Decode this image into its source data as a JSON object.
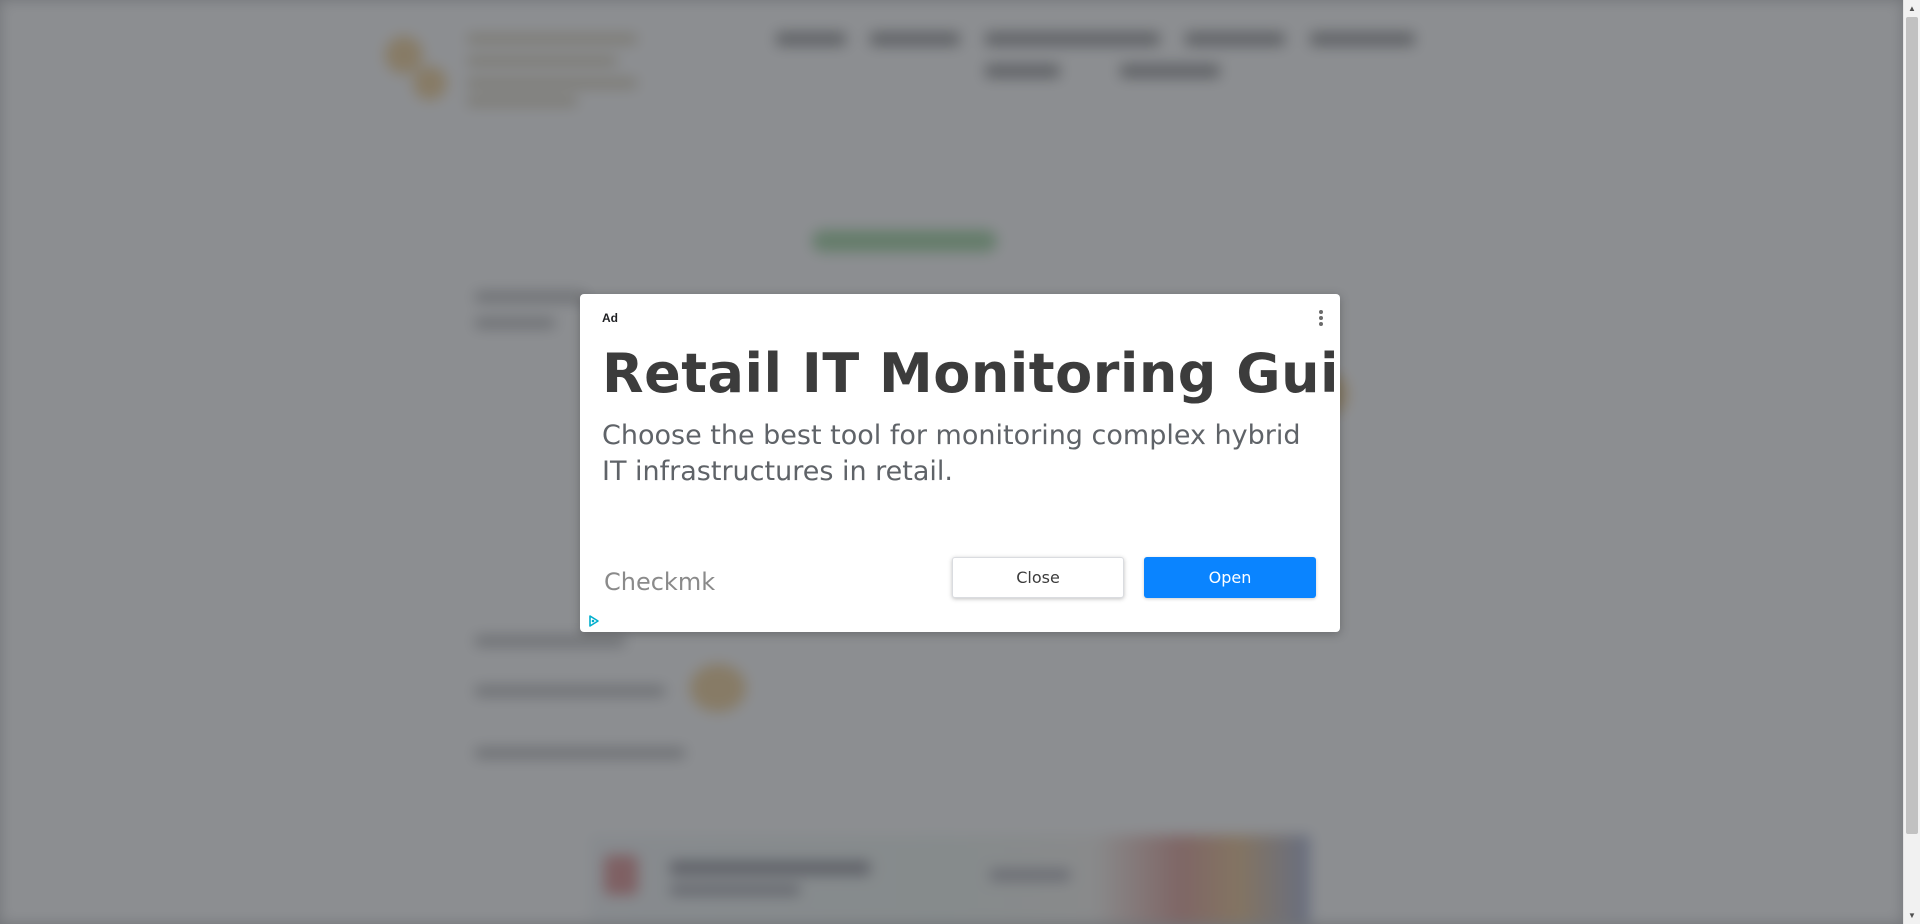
{
  "ad": {
    "label": "Ad",
    "headline": "Retail IT Monitoring Guide",
    "description": "Choose the best tool for monitoring complex hybrid IT infrastructures in retail.",
    "advertiser": "Checkmk",
    "close_label": "Close",
    "open_label": "Open",
    "menu_icon": "more-vert-icon",
    "adchoices_icon": "adchoices-icon"
  },
  "scrollbar": {
    "up_arrow": "▲",
    "down_arrow": "▼"
  },
  "colors": {
    "open_button": "#0a84ff",
    "overlay": "#6c6e72",
    "adchoices": "#00aecd"
  }
}
